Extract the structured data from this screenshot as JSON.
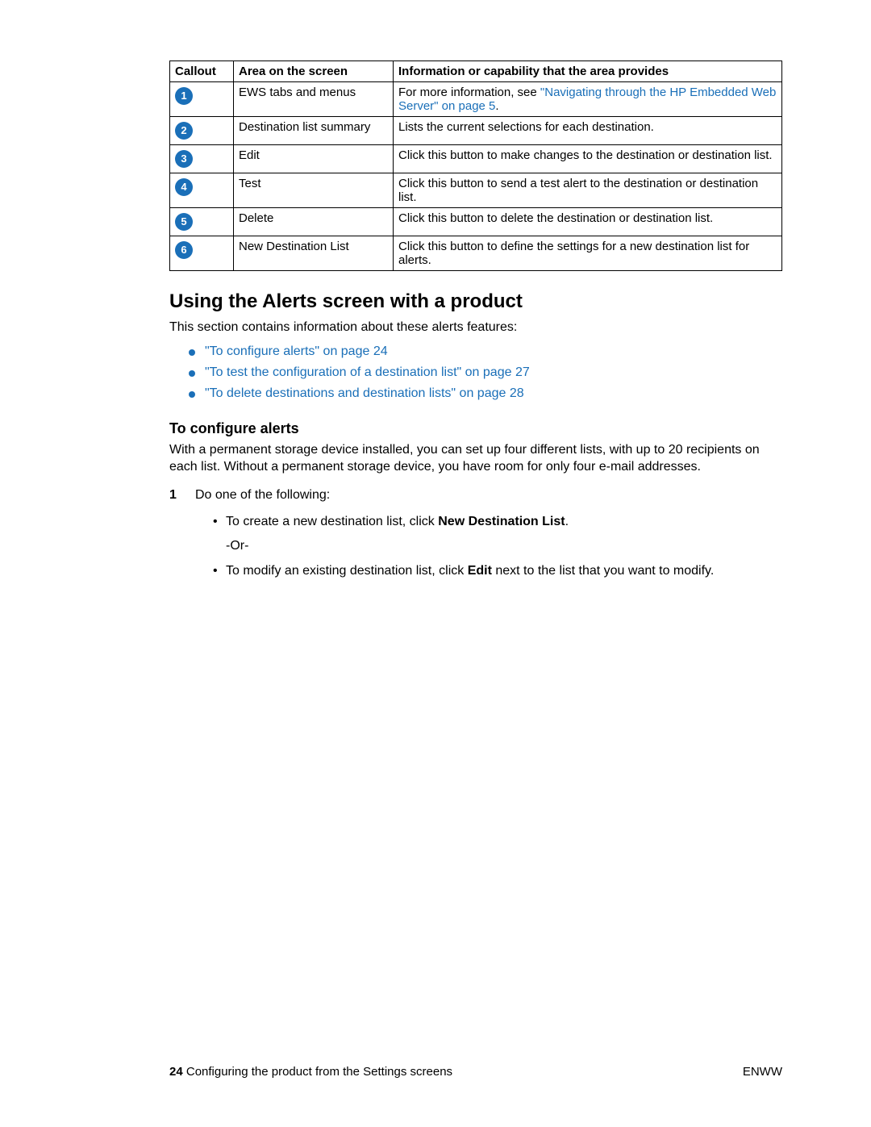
{
  "table": {
    "headers": [
      "Callout",
      "Area on the screen",
      "Information or capability that the area provides"
    ],
    "rows": [
      {
        "num": "1",
        "area": "EWS tabs and menus",
        "info_pre": "For more information, see ",
        "info_link": "\"Navigating through the HP Embedded Web Server\" on page 5",
        "info_post": "."
      },
      {
        "num": "2",
        "area": "Destination list summary",
        "info": "Lists the current selections for each destination."
      },
      {
        "num": "3",
        "area": "Edit",
        "info": "Click this button to make changes to the destination or destination list."
      },
      {
        "num": "4",
        "area": "Test",
        "info": "Click this button to send a test alert to the destination or destination list."
      },
      {
        "num": "5",
        "area": "Delete",
        "info": "Click this button to delete the destination or destination list."
      },
      {
        "num": "6",
        "area": "New Destination List",
        "info": "Click this button to define the settings for a new destination list for alerts."
      }
    ]
  },
  "section_heading": "Using the Alerts screen with a product",
  "section_intro": "This section contains information about these alerts features:",
  "bullets": [
    "\"To configure alerts\" on page 24",
    "\"To test the configuration of a destination list\" on page 27",
    "\"To delete destinations and destination lists\" on page 28"
  ],
  "sub_heading": "To configure alerts",
  "sub_intro": "With a permanent storage device installed, you can set up four different lists, with up to 20 recipients on each list. Without a permanent storage device, you have room for only four e-mail addresses.",
  "step1_lead": "Do one of the following:",
  "step1_a_pre": "To create a new destination list, click ",
  "step1_a_bold": "New Destination List",
  "step1_a_post": ".",
  "step1_or": "-Or-",
  "step1_b_pre": "To modify an existing destination list, click ",
  "step1_b_bold": "Edit",
  "step1_b_post": " next to the list that you want to modify.",
  "footer": {
    "page_num": "24",
    "chapter": " Configuring the product from the Settings screens",
    "lang": "ENWW"
  }
}
